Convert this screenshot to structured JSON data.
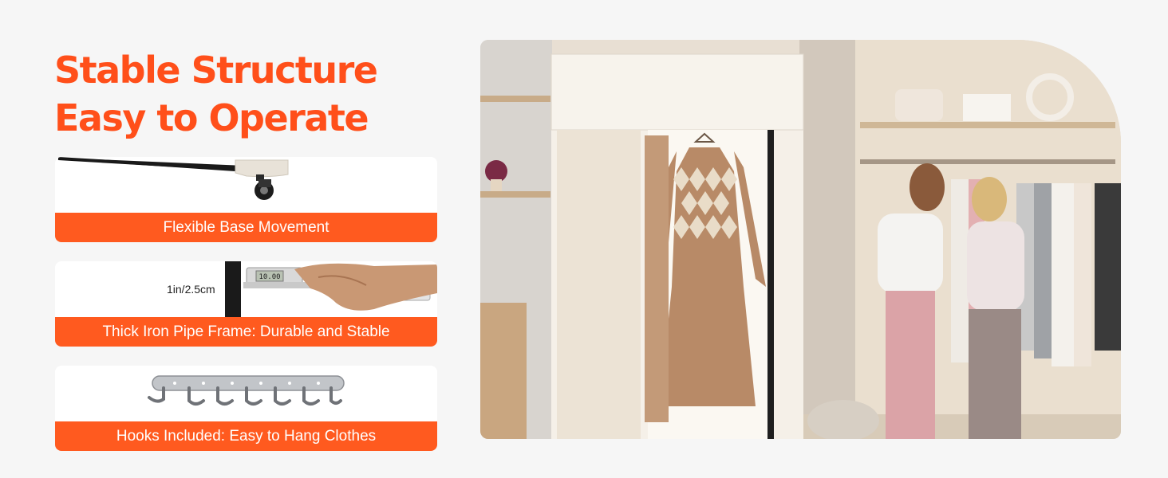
{
  "headline": {
    "line1": "Stable Structure",
    "line2": "Easy to Operate"
  },
  "features": [
    {
      "caption": "Flexible Base Movement",
      "icon": "caster-wheel-icon"
    },
    {
      "caption": "Thick Iron Pipe Frame: Durable and Stable",
      "icon": "caliper-icon",
      "measurement": "1in/2.5cm",
      "caliper_reading": "10.00"
    },
    {
      "caption": "Hooks Included: Easy to Hang Clothes",
      "icon": "hook-rail-icon"
    }
  ],
  "colors": {
    "accent": "#ff5a1f",
    "headline": "#ff4f1a",
    "background": "#f6f6f6"
  }
}
